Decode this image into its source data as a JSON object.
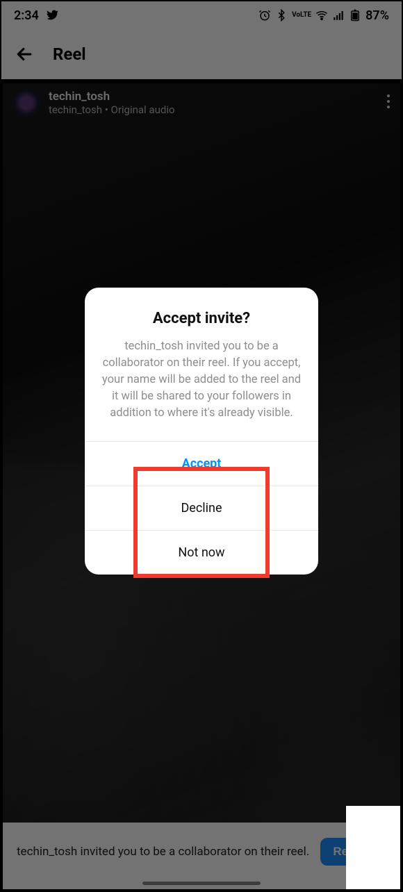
{
  "status": {
    "time": "2:34",
    "battery": "87%"
  },
  "header": {
    "title": "Reel"
  },
  "reel": {
    "username": "techin_tosh",
    "audio_line": "techin_tosh • Original audio"
  },
  "modal": {
    "title": "Accept invite?",
    "description": "techin_tosh invited you to be a collaborator on their reel. If you accept, your name will be added to the reel and it will be shared to your followers in addition to where it's already visible.",
    "accept_label": "Accept",
    "decline_label": "Decline",
    "notnow_label": "Not now"
  },
  "bottom": {
    "message": "techin_tosh invited you to be a collaborator on their reel.",
    "review_label": "Review"
  }
}
